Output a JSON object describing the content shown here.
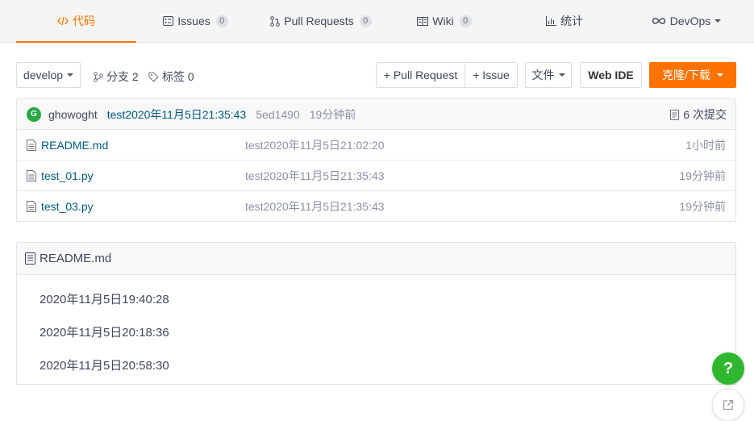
{
  "tabs": [
    {
      "label": "代码",
      "icon": "code-icon",
      "active": true
    },
    {
      "label": "Issues",
      "icon": "issues-icon",
      "count": "0"
    },
    {
      "label": "Pull Requests",
      "icon": "pull-request-icon",
      "count": "0"
    },
    {
      "label": "Wiki",
      "icon": "wiki-icon",
      "count": "0"
    },
    {
      "label": "统计",
      "icon": "stats-icon"
    },
    {
      "label": "DevOps",
      "icon": "infinity-icon"
    }
  ],
  "toolbar": {
    "branch": "develop",
    "branches_label": "分支 2",
    "tags_label": "标签 0",
    "pull_request_btn": "+ Pull Request",
    "issue_btn": "+ Issue",
    "file_btn": "文件",
    "web_ide_btn": "Web IDE",
    "clone_btn": "克隆/下载"
  },
  "commit": {
    "avatar_letter": "G",
    "author": "ghowoght",
    "message": "test2020年11月5日21:35:43",
    "sha": "5ed1490",
    "time": "19分钟前",
    "count_label": "6 次提交"
  },
  "files": [
    {
      "name": "README.md",
      "message": "test2020年11月5日21:02:20",
      "time": "1小时前"
    },
    {
      "name": "test_01.py",
      "message": "test2020年11月5日21:35:43",
      "time": "19分钟前"
    },
    {
      "name": "test_03.py",
      "message": "test2020年11月5日21:35:43",
      "time": "19分钟前"
    }
  ],
  "readme": {
    "title": "README.md",
    "lines": [
      "2020年11月5日19:40:28",
      "2020年11月5日20:18:36",
      "2020年11月5日20:58:30"
    ]
  },
  "floating": {
    "help_label": "?"
  },
  "colors": {
    "accent": "#fe7300",
    "link": "#005980",
    "help": "#2fb82f"
  }
}
